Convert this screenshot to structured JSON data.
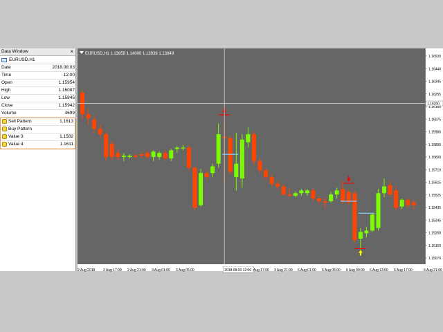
{
  "data_window": {
    "title": "Data Window",
    "close_glyph": "×",
    "symbol": "EURUSD,H1",
    "rows": [
      {
        "label": "Date",
        "value": "2018.08.03"
      },
      {
        "label": "Time",
        "value": "12:00"
      },
      {
        "label": "Open",
        "value": "1.15954"
      },
      {
        "label": "High",
        "value": "1.16087"
      },
      {
        "label": "Low",
        "value": "1.15845"
      },
      {
        "label": "Close",
        "value": "1.15942"
      },
      {
        "label": "Volume",
        "value": "3699"
      }
    ],
    "indicators": [
      {
        "label": "Sell Pattern",
        "value": "1.1613"
      },
      {
        "label": "Buy Pattern",
        "value": ""
      },
      {
        "label": "Value 3",
        "value": "1.1582"
      },
      {
        "label": "Value 4",
        "value": "1.1611"
      }
    ]
  },
  "chart": {
    "header": "EURUSD,H1  1.13958 1.14000 1.13939 1.13949",
    "crosshair_price": "1.16200",
    "crosshair_time": "2018.08.03 12:00",
    "colors": {
      "background": "#666666",
      "bull": "#7cfc00",
      "bear": "#ff4500",
      "signal": "#ff0000",
      "buy_arrow": "#ffff00",
      "level": "#87cefa"
    },
    "price_ticks": [
      "1.16530",
      "1.16440",
      "1.16345",
      "1.16255",
      "1.16165",
      "1.16075",
      "1.15980",
      "1.15890",
      "1.15800",
      "1.15710",
      "1.15615",
      "1.15525",
      "1.15435",
      "1.15345",
      "1.15250",
      "1.15160",
      "1.15070"
    ],
    "time_labels": [
      "2 Aug 2018",
      "2 Aug 17:00",
      "2 Aug 21:00",
      "3 Aug 01:00",
      "3 Aug 05:00",
      "3 Aug 13:00",
      "3 Aug 17:00",
      "3 Aug 21:00",
      "6 Aug 01:00",
      "6 Aug 05:00",
      "6 Aug 09:00",
      "6 Aug 13:00",
      "6 Aug 17:00",
      "6 Aug 21:00"
    ]
  },
  "chart_data": {
    "type": "candlestick",
    "ylim": [
      1.1503,
      1.1658
    ],
    "candles": [
      {
        "o": 1.1628,
        "h": 1.163,
        "l": 1.1608,
        "c": 1.1612
      },
      {
        "o": 1.1612,
        "h": 1.1616,
        "l": 1.1604,
        "c": 1.1609
      },
      {
        "o": 1.1608,
        "h": 1.161,
        "l": 1.1598,
        "c": 1.1601
      },
      {
        "o": 1.1601,
        "h": 1.1604,
        "l": 1.1594,
        "c": 1.1597
      },
      {
        "o": 1.1597,
        "h": 1.1599,
        "l": 1.1577,
        "c": 1.158
      },
      {
        "o": 1.159,
        "h": 1.1592,
        "l": 1.1578,
        "c": 1.158
      },
      {
        "o": 1.1583,
        "h": 1.1586,
        "l": 1.1578,
        "c": 1.158
      },
      {
        "o": 1.158,
        "h": 1.1583,
        "l": 1.1577,
        "c": 1.1581
      },
      {
        "o": 1.158,
        "h": 1.1582,
        "l": 1.1579,
        "c": 1.1581
      },
      {
        "o": 1.1581,
        "h": 1.1583,
        "l": 1.1579,
        "c": 1.158
      },
      {
        "o": 1.1582,
        "h": 1.1584,
        "l": 1.1579,
        "c": 1.1581
      },
      {
        "o": 1.1583,
        "h": 1.1585,
        "l": 1.1579,
        "c": 1.158
      },
      {
        "o": 1.158,
        "h": 1.1585,
        "l": 1.1577,
        "c": 1.1584
      },
      {
        "o": 1.158,
        "h": 1.1584,
        "l": 1.1578,
        "c": 1.1583
      },
      {
        "o": 1.1583,
        "h": 1.1585,
        "l": 1.1577,
        "c": 1.1579
      },
      {
        "o": 1.1579,
        "h": 1.1586,
        "l": 1.1577,
        "c": 1.1585
      },
      {
        "o": 1.1586,
        "h": 1.1588,
        "l": 1.1583,
        "c": 1.1587
      },
      {
        "o": 1.1587,
        "h": 1.1589,
        "l": 1.1585,
        "c": 1.1587
      },
      {
        "o": 1.1587,
        "h": 1.1589,
        "l": 1.157,
        "c": 1.1572
      },
      {
        "o": 1.1572,
        "h": 1.1573,
        "l": 1.154,
        "c": 1.1542
      },
      {
        "o": 1.1544,
        "h": 1.1571,
        "l": 1.1543,
        "c": 1.1568
      },
      {
        "o": 1.1568,
        "h": 1.157,
        "l": 1.1563,
        "c": 1.1565
      },
      {
        "o": 1.1568,
        "h": 1.1575,
        "l": 1.1565,
        "c": 1.1573
      },
      {
        "o": 1.1575,
        "h": 1.1605,
        "l": 1.1572,
        "c": 1.1597
      },
      {
        "o": 1.1595,
        "h": 1.1609,
        "l": 1.1561,
        "c": 1.1594
      },
      {
        "o": 1.1594,
        "h": 1.1596,
        "l": 1.1567,
        "c": 1.1569
      },
      {
        "o": 1.1565,
        "h": 1.1598,
        "l": 1.1555,
        "c": 1.1575
      },
      {
        "o": 1.1564,
        "h": 1.1597,
        "l": 1.1557,
        "c": 1.1593
      },
      {
        "o": 1.1591,
        "h": 1.1602,
        "l": 1.1587,
        "c": 1.1597
      },
      {
        "o": 1.1597,
        "h": 1.1599,
        "l": 1.1574,
        "c": 1.1577
      },
      {
        "o": 1.1577,
        "h": 1.1579,
        "l": 1.1568,
        "c": 1.157
      },
      {
        "o": 1.157,
        "h": 1.1572,
        "l": 1.1563,
        "c": 1.1565
      },
      {
        "o": 1.1565,
        "h": 1.1567,
        "l": 1.1558,
        "c": 1.156
      },
      {
        "o": 1.156,
        "h": 1.1562,
        "l": 1.1556,
        "c": 1.1558
      },
      {
        "o": 1.1558,
        "h": 1.156,
        "l": 1.1551,
        "c": 1.1552
      },
      {
        "o": 1.1552,
        "h": 1.1557,
        "l": 1.155,
        "c": 1.1551
      },
      {
        "o": 1.1551,
        "h": 1.1554,
        "l": 1.155,
        "c": 1.1553
      },
      {
        "o": 1.1553,
        "h": 1.1556,
        "l": 1.1551,
        "c": 1.1555
      },
      {
        "o": 1.1553,
        "h": 1.1556,
        "l": 1.1551,
        "c": 1.1555
      },
      {
        "o": 1.1555,
        "h": 1.1557,
        "l": 1.1547,
        "c": 1.1549
      },
      {
        "o": 1.1549,
        "h": 1.1551,
        "l": 1.1545,
        "c": 1.1547
      },
      {
        "o": 1.1547,
        "h": 1.155,
        "l": 1.1542,
        "c": 1.1546
      },
      {
        "o": 1.1547,
        "h": 1.1554,
        "l": 1.1546,
        "c": 1.1552
      },
      {
        "o": 1.1552,
        "h": 1.1557,
        "l": 1.1549,
        "c": 1.1555
      },
      {
        "o": 1.1556,
        "h": 1.1562,
        "l": 1.1545,
        "c": 1.1547
      },
      {
        "o": 1.1554,
        "h": 1.1556,
        "l": 1.1544,
        "c": 1.1546
      },
      {
        "o": 1.1553,
        "h": 1.1555,
        "l": 1.1516,
        "c": 1.1518
      },
      {
        "o": 1.1519,
        "h": 1.1527,
        "l": 1.1511,
        "c": 1.1524
      },
      {
        "o": 1.1523,
        "h": 1.1528,
        "l": 1.152,
        "c": 1.1525
      },
      {
        "o": 1.1525,
        "h": 1.1538,
        "l": 1.1524,
        "c": 1.1537
      },
      {
        "o": 1.1527,
        "h": 1.1556,
        "l": 1.1525,
        "c": 1.1553
      },
      {
        "o": 1.1553,
        "h": 1.1564,
        "l": 1.155,
        "c": 1.1558
      },
      {
        "o": 1.1559,
        "h": 1.1562,
        "l": 1.155,
        "c": 1.1552
      },
      {
        "o": 1.1555,
        "h": 1.1558,
        "l": 1.154,
        "c": 1.1542
      },
      {
        "o": 1.1543,
        "h": 1.1549,
        "l": 1.1541,
        "c": 1.1548
      },
      {
        "o": 1.1548,
        "h": 1.1549,
        "l": 1.1542,
        "c": 1.1544
      },
      {
        "o": 1.1546,
        "h": 1.1548,
        "l": 1.1541,
        "c": 1.1544
      }
    ],
    "sell_signals": [
      {
        "index": 24,
        "price": 1.1613
      },
      {
        "index": 45,
        "price": 1.1562
      }
    ],
    "buy_signals": [
      {
        "index": 47,
        "price": 1.151
      }
    ],
    "levels": [
      {
        "from": 24,
        "to": 26,
        "price": 1.1582
      },
      {
        "from": 44,
        "to": 46,
        "price": 1.1547
      },
      {
        "from": 47,
        "to": 49,
        "price": 1.1538
      }
    ],
    "crosshair": {
      "index": 24,
      "price": 1.162
    }
  }
}
